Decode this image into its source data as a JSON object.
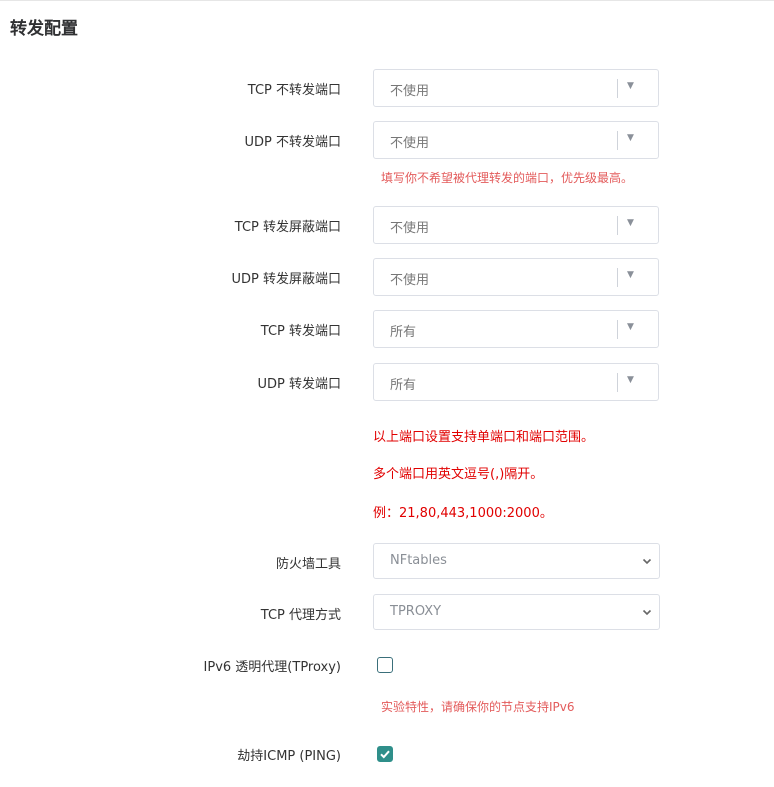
{
  "section": {
    "title": "转发配置"
  },
  "fields": {
    "tcp_no_redir": {
      "label": "TCP 不转发端口",
      "value": "不使用"
    },
    "udp_no_redir": {
      "label": "UDP 不转发端口",
      "value": "不使用"
    },
    "no_redir_hint": "填写你不希望被代理转发的端口，优先级最高。",
    "tcp_block": {
      "label": "TCP 转发屏蔽端口",
      "value": "不使用"
    },
    "udp_block": {
      "label": "UDP 转发屏蔽端口",
      "value": "不使用"
    },
    "tcp_redir": {
      "label": "TCP 转发端口",
      "value": "所有"
    },
    "udp_redir": {
      "label": "UDP 转发端口",
      "value": "所有"
    },
    "port_notes": [
      "以上端口设置支持单端口和端口范围。",
      "多个端口用英文逗号(,)隔开。",
      "例：21,80,443,1000:2000。"
    ],
    "firewall": {
      "label": "防火墙工具",
      "value": "NFtables"
    },
    "tcp_proxy_way": {
      "label": "TCP 代理方式",
      "value": "TPROXY"
    },
    "ipv6_tproxy": {
      "label": "IPv6 透明代理(TProxy)",
      "checked": false,
      "hint": "实验特性，请确保你的节点支持IPv6"
    },
    "hijack_icmp": {
      "label": "劫持ICMP (PING)",
      "checked": true
    }
  },
  "colors": {
    "accent": "#2f8f8a",
    "error_soft": "#e35b5b",
    "error_strong": "#e10000"
  }
}
